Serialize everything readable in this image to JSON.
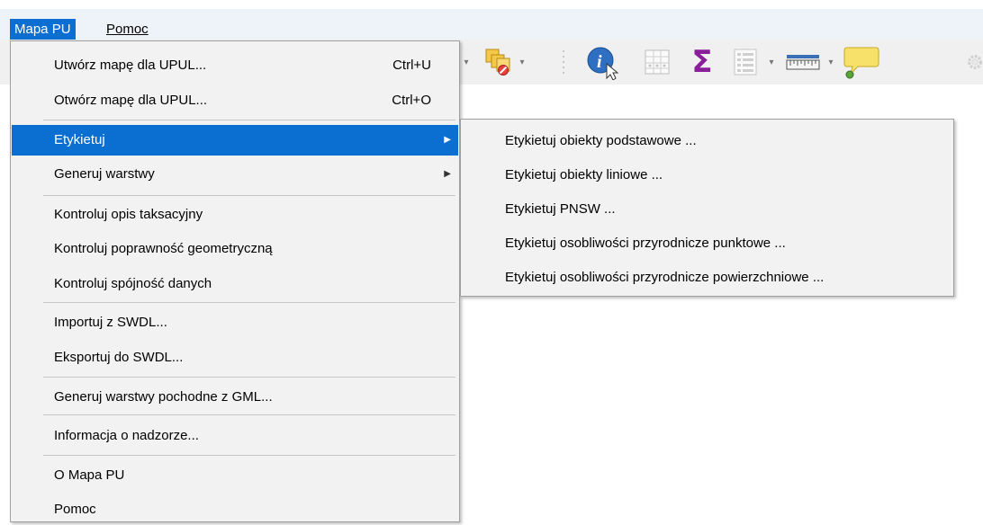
{
  "menubar": {
    "items": [
      {
        "label": "Mapa PU"
      },
      {
        "label": "Pomoc"
      }
    ]
  },
  "toolbar": {
    "icons": [
      "select-features-icon",
      "deselect-features-icon",
      "identify-features-icon",
      "attribute-table-icon",
      "statistics-sum-icon",
      "field-calculator-icon",
      "measure-ruler-icon",
      "map-tips-icon",
      "settings-gear-icon"
    ],
    "sum_symbol": "Σ"
  },
  "main_menu": {
    "items": [
      {
        "label": "Utwórz mapę dla UPUL...",
        "shortcut": "Ctrl+U"
      },
      {
        "label": "Otwórz mapę dla UPUL...",
        "shortcut": "Ctrl+O"
      },
      {
        "label": "Etykietuj",
        "submenu": true,
        "highlighted": true
      },
      {
        "label": "Generuj warstwy",
        "submenu": true
      },
      {
        "label": "Kontroluj opis taksacyjny"
      },
      {
        "label": "Kontroluj poprawność geometryczną"
      },
      {
        "label": "Kontroluj spójność danych"
      },
      {
        "label": "Importuj z SWDL..."
      },
      {
        "label": "Eksportuj do SWDL..."
      },
      {
        "label": "Generuj warstwy pochodne z GML..."
      },
      {
        "label": "Informacja o nadzorze..."
      },
      {
        "label": "O Mapa PU"
      },
      {
        "label": "Pomoc"
      }
    ]
  },
  "submenu": {
    "items": [
      {
        "label": "Etykietuj obiekty podstawowe ..."
      },
      {
        "label": "Etykietuj obiekty liniowe ..."
      },
      {
        "label": "Etykietuj PNSW ..."
      },
      {
        "label": "Etykietuj osobliwości przyrodnicze punktowe ..."
      },
      {
        "label": "Etykietuj osobliwości przyrodnicze powierzchniowe ..."
      }
    ]
  },
  "colors": {
    "highlight": "#0a6fd1",
    "menu_bg": "#f2f2f2",
    "menubar_bg": "#eef3f9"
  }
}
